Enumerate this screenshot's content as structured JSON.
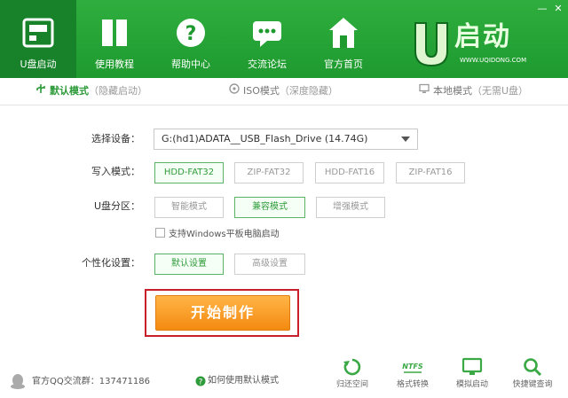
{
  "nav": [
    {
      "label": "U盘启动",
      "icon": "usb-drive-icon",
      "active": true
    },
    {
      "label": "使用教程",
      "icon": "book-icon",
      "active": false
    },
    {
      "label": "帮助中心",
      "icon": "question-icon",
      "active": false
    },
    {
      "label": "交流论坛",
      "icon": "chat-icon",
      "active": false
    },
    {
      "label": "官方首页",
      "icon": "home-icon",
      "active": false
    }
  ],
  "window": {
    "min": "—",
    "close": "✕"
  },
  "logo": {
    "brand": "启动",
    "url": "WWW.UQIDONG.COM"
  },
  "modes": [
    {
      "main": "默认模式",
      "sub": "（隐藏启动）",
      "icon": "usb-icon",
      "active": true
    },
    {
      "main": "ISO模式",
      "sub": "（深度隐藏）",
      "icon": "disc-icon",
      "active": false
    },
    {
      "main": "本地模式",
      "sub": "（无需U盘）",
      "icon": "monitor-icon",
      "active": false
    }
  ],
  "form": {
    "device_label": "选择设备：",
    "device_value": "G:(hd1)ADATA__USB_Flash_Drive (14.74G)",
    "write_label": "写入模式：",
    "write_options": [
      "HDD-FAT32",
      "ZIP-FAT32",
      "HDD-FAT16",
      "ZIP-FAT16"
    ],
    "write_selected": "HDD-FAT32",
    "partition_label": "U盘分区：",
    "partition_options": [
      "智能模式",
      "兼容模式",
      "增强模式"
    ],
    "partition_selected": "兼容模式",
    "tablet_checkbox": "支持Windows平板电脑启动",
    "tablet_checked": false,
    "personal_label": "个性化设置：",
    "personal_options": [
      "默认设置",
      "高级设置"
    ],
    "personal_selected": "默认设置"
  },
  "start_button": "开始制作",
  "footer": {
    "qq_group": "官方QQ交流群：137471186",
    "help_link": "如何使用默认模式",
    "tools": [
      {
        "label": "归还空间",
        "icon": "restore-icon"
      },
      {
        "label": "格式转换",
        "icon": "ntfs-icon"
      },
      {
        "label": "模拟启动",
        "icon": "monitor-icon"
      },
      {
        "label": "快捷键查询",
        "icon": "search-icon"
      }
    ]
  },
  "colors": {
    "accent": "#1e9a2f",
    "active_nav": "#17822a",
    "start_button": "#f48a10",
    "highlight_frame": "#c8202a"
  }
}
